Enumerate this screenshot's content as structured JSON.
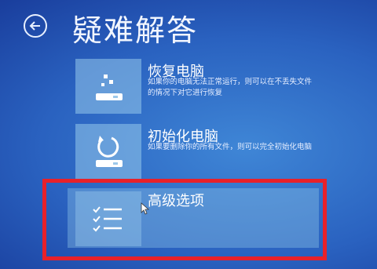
{
  "header": {
    "title": "疑难解答"
  },
  "options": [
    {
      "title": "恢复电脑",
      "description": "如果你的电脑无法正常运行，则可以在不丢失文件的情况下对它进行恢复",
      "icon": "refresh-pc-icon"
    },
    {
      "title": "初始化电脑",
      "description": "如果要删除你的所有文件，则可以完全初始化电脑",
      "icon": "reset-pc-icon"
    },
    {
      "title": "高级选项",
      "description": "",
      "icon": "checklist-icon"
    }
  ],
  "colors": {
    "background": "#2a62c0",
    "tile": "#96c8eb",
    "highlight_border": "#e8212a"
  }
}
